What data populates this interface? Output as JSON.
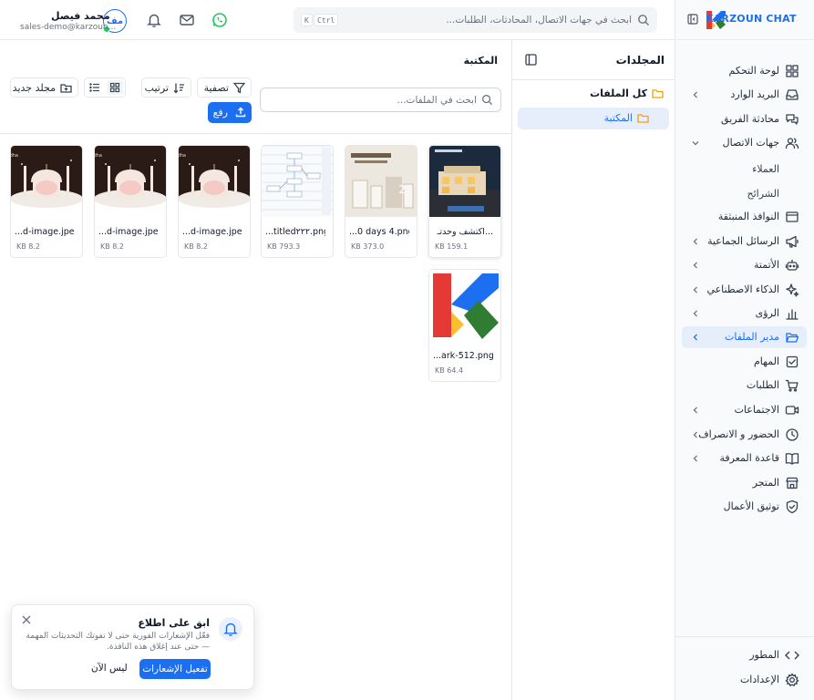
{
  "brand": {
    "name": "KARZOUN CHAT"
  },
  "header": {
    "search_placeholder": "ابحث في جهات الاتصال، المحادثات، الطلبات...",
    "kbd_ctrl": "Ctrl",
    "kbd_k": "K",
    "user_name": "محمد فيصل",
    "user_email": "sales-demo@karzoun...",
    "avatar_initials": "مف"
  },
  "sidebar": {
    "items": [
      {
        "label": "لوحة التحكم",
        "icon": "dashboard-icon",
        "chevron": false
      },
      {
        "label": "البريد الوارد",
        "icon": "inbox-icon",
        "chevron": true
      },
      {
        "label": "محادثة الفريق",
        "icon": "chat-icon",
        "chevron": false
      },
      {
        "label": "جهات الاتصال",
        "icon": "users-icon",
        "chevron": true,
        "expanded": true
      },
      {
        "label": "النوافذ المنبثقة",
        "icon": "popup-icon",
        "chevron": false
      },
      {
        "label": "الرسائل الجماعية",
        "icon": "megaphone-icon",
        "chevron": true
      },
      {
        "label": "الأتمتة",
        "icon": "bot-icon",
        "chevron": true
      },
      {
        "label": "الذكاء الاصطناعي",
        "icon": "sparkles-icon",
        "chevron": true
      },
      {
        "label": "الرؤى",
        "icon": "chart-icon",
        "chevron": true
      },
      {
        "label": "مدير الملفات",
        "icon": "folder-open-icon",
        "chevron": true,
        "active": true
      },
      {
        "label": "المهام",
        "icon": "task-icon",
        "chevron": false
      },
      {
        "label": "الطلبات",
        "icon": "cart-icon",
        "chevron": false
      },
      {
        "label": "الاجتماعات",
        "icon": "video-icon",
        "chevron": true
      },
      {
        "label": "الحضور و الانصراف",
        "icon": "clock-icon",
        "chevron": true
      },
      {
        "label": "قاعدة المعرفة",
        "icon": "book-icon",
        "chevron": true
      },
      {
        "label": "المتجر",
        "icon": "store-icon",
        "chevron": false
      },
      {
        "label": "توثيق الأعمال",
        "icon": "shield-check-icon",
        "chevron": false
      }
    ],
    "contacts_sub": [
      "العملاء",
      "الشرائح"
    ],
    "bottom": [
      {
        "label": "المطور",
        "icon": "code-icon"
      },
      {
        "label": "الإعدادات",
        "icon": "gear-icon"
      }
    ]
  },
  "folders": {
    "title": "المجلدات",
    "all_files": "كل الملفات",
    "library": "المكتبة"
  },
  "library": {
    "title": "المكتبة",
    "search_placeholder": "ابحث في الملفات...",
    "filter_label": "تصفية",
    "sort_label": "ترتيب",
    "new_folder_label": "مجلد جديد",
    "upload_label": "رفع"
  },
  "files": [
    {
      "name": "اكتشف وحدتـ...",
      "size": "159.1 KB",
      "thumb": "villa"
    },
    {
      "name": "...0 days 4.png",
      "size": "373.0 KB",
      "thumb": "product"
    },
    {
      "name": "...titled٢٢٢.png",
      "size": "793.3 KB",
      "thumb": "diagram"
    },
    {
      "name": "...d-image.jpeg",
      "size": "8.2 KB",
      "thumb": "eid"
    },
    {
      "name": "...d-image.jpeg",
      "size": "8.2 KB",
      "thumb": "eid"
    },
    {
      "name": "...d-image.jpeg",
      "size": "8.2 KB",
      "thumb": "eid"
    },
    {
      "name": "...ark-512.png",
      "size": "64.4 KB",
      "thumb": "logo"
    }
  ],
  "toast": {
    "title": "ابق على اطلاع",
    "body_line1": "فعّل الإشعارات الفورية حتى لا تفوتك التحديثات المهمة",
    "body_line2": "— حتى عند إغلاق هذه النافذة.",
    "enable_label": "تفعيل الإشعارات",
    "later_label": "ليس الآن"
  },
  "colors": {
    "accent": "#1d6ff2",
    "active_bg": "#e6eefc",
    "folder": "#f59e0b",
    "online": "#22c55e"
  }
}
